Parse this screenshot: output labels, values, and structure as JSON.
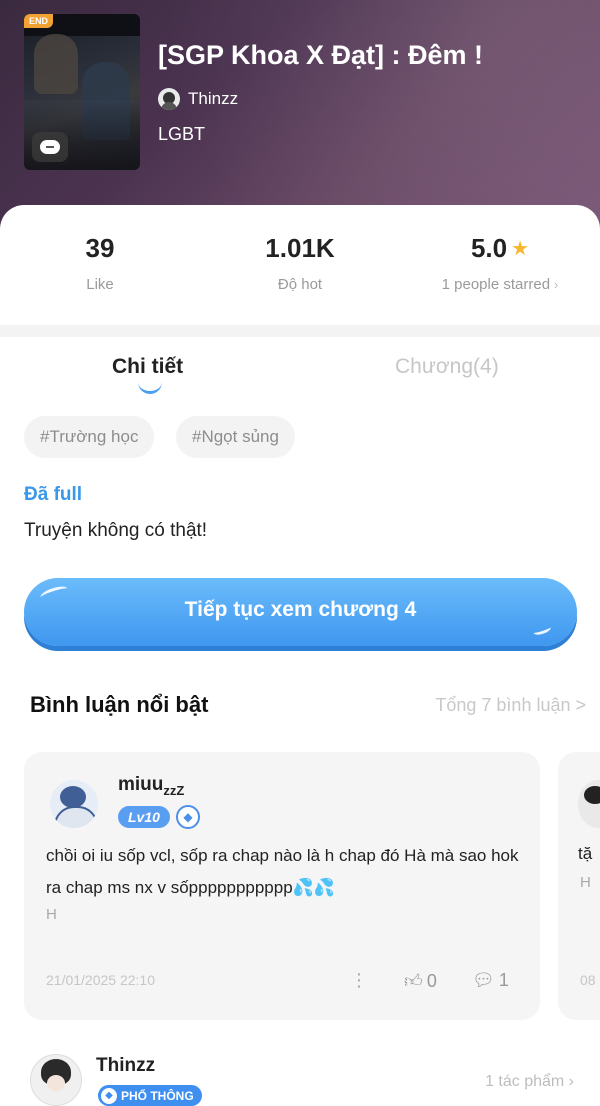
{
  "header": {
    "title": "[SGP Khoa X Đạt] : Đêm !",
    "author": "Thinzz",
    "genre": "LGBT",
    "cover_badge": "END"
  },
  "stats": {
    "like_value": "39",
    "like_label": "Like",
    "hot_value": "1.01K",
    "hot_label": "Độ hot",
    "rating_value": "5.0",
    "rating_label": "1 people starred"
  },
  "tabs": {
    "detail": "Chi tiết",
    "chapters": "Chương(4)"
  },
  "tags": [
    "#Trường học",
    "#Ngọt sủng"
  ],
  "status": "Đã full",
  "description": "Truyện không có thật!",
  "continue_button": "Tiếp tục xem chương 4",
  "comments_section": {
    "title": "Bình luận nổi bật",
    "total": "Tổng 7 bình luận >"
  },
  "comments": [
    {
      "user": "miuu",
      "user_suffix": "zzZ",
      "level": "Lv10",
      "text": "chồi oi iu sốp vcl, sốp ra chap nào là h chap đó Hà mà sao hok ra chap ms nx v sốppppppppppp💦💦",
      "sub": "H",
      "date": "21/01/2025 22:10",
      "likes": "0",
      "replies": "1"
    },
    {
      "text": "tặ",
      "sub": "H",
      "date": "08"
    }
  ],
  "author_footer": {
    "name": "Thinzz",
    "badge": "PHỔ THÔNG",
    "works": "1 tác phẩm"
  },
  "colors": {
    "accent": "#3f97ef",
    "star": "#f5b72c",
    "status": "#3a98ea"
  }
}
